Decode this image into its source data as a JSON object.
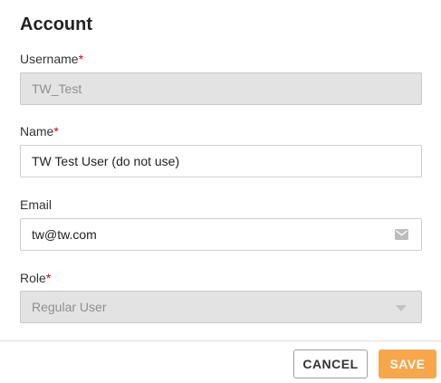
{
  "section": {
    "title": "Account"
  },
  "fields": {
    "username": {
      "label": "Username",
      "required_mark": "*",
      "value": "TW_Test",
      "disabled": true
    },
    "name": {
      "label": "Name",
      "required_mark": "*",
      "value": "TW Test User (do not use)"
    },
    "email": {
      "label": "Email",
      "value": "tw@tw.com",
      "icon": "envelope-icon"
    },
    "role": {
      "label": "Role",
      "required_mark": "*",
      "value": "Regular User",
      "disabled": true,
      "icon": "chevron-down-icon"
    }
  },
  "actions": {
    "cancel_label": "CANCEL",
    "save_label": "SAVE"
  },
  "colors": {
    "required": "#d0021b",
    "save_button": "#f7a64a",
    "disabled_field": "#e3e3e3"
  }
}
